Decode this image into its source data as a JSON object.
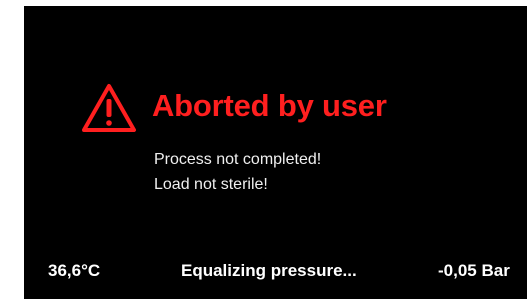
{
  "alert": {
    "icon": "warning-triangle-icon",
    "title": "Aborted by user",
    "color": "#ff1f1f",
    "messages": [
      "Process not completed!",
      "Load not sterile!"
    ]
  },
  "status_bar": {
    "temperature": "36,6°C",
    "phase": "Equalizing pressure...",
    "pressure": "-0,05 Bar"
  },
  "theme": {
    "background": "#000000",
    "text": "#ffffff"
  }
}
